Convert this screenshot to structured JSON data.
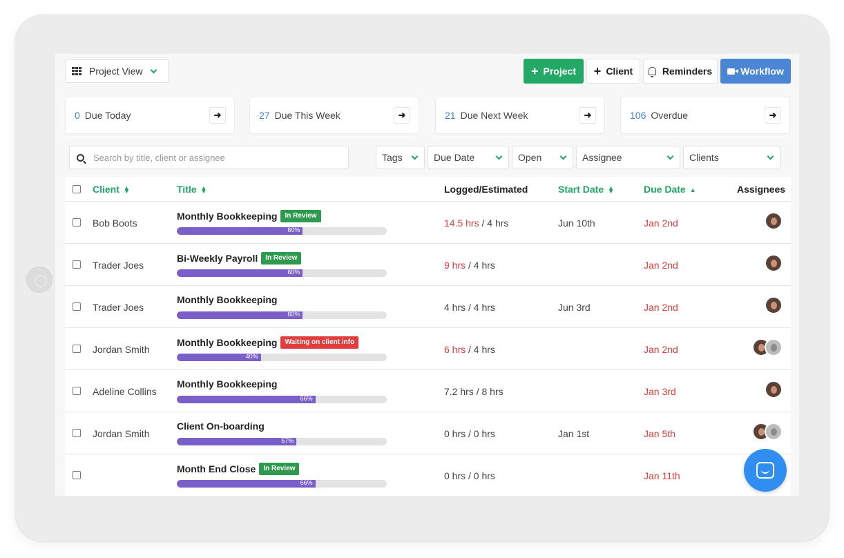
{
  "toolbar": {
    "view_label": "Project View",
    "project_label": "Project",
    "client_label": "Client",
    "reminders_label": "Reminders",
    "workflow_label": "Workflow"
  },
  "due_cards": [
    {
      "count": "0",
      "label": "Due Today"
    },
    {
      "count": "27",
      "label": "Due This Week"
    },
    {
      "count": "21",
      "label": "Due Next Week"
    },
    {
      "count": "106",
      "label": "Overdue"
    }
  ],
  "search": {
    "placeholder": "Search by title, client or assignee"
  },
  "filters": {
    "tags": "Tags",
    "due_date": "Due Date",
    "status": "Open",
    "assignee": "Assignee",
    "clients": "Clients"
  },
  "table": {
    "headers": {
      "client": "Client",
      "title": "Title",
      "logged": "Logged/Estimated",
      "start": "Start Date",
      "due": "Due Date",
      "assignees": "Assignees"
    },
    "rows": [
      {
        "client": "Bob Boots",
        "title": "Monthly Bookkeeping",
        "badge": "In Review",
        "progress_label": "60%",
        "logged": "14.5 hrs",
        "estimated": "/ 4 hrs",
        "start": "Jun 10th",
        "due": "Jan 2nd"
      },
      {
        "client": "Trader Joes",
        "title": "Bi-Weekly Payroll",
        "badge": "In Review",
        "progress_label": "60%",
        "logged": "9 hrs",
        "estimated": "/ 4 hrs",
        "start": "",
        "due": "Jan 2nd"
      },
      {
        "client": "Trader Joes",
        "title": "Monthly Bookkeeping",
        "badge": "",
        "progress_label": "60%",
        "logged": "4 hrs",
        "estimated": "/ 4 hrs",
        "start": "Jun 3rd",
        "due": "Jan 2nd"
      },
      {
        "client": "Jordan Smith",
        "title": "Monthly Bookkeeping",
        "badge": "Waiting on client info",
        "progress_label": "40%",
        "logged": "6 hrs",
        "estimated": "/ 4 hrs",
        "start": "",
        "due": "Jan 2nd"
      },
      {
        "client": "Adeline Collins",
        "title": "Monthly Bookkeeping",
        "badge": "",
        "progress_label": "66%",
        "logged": "7.2 hrs",
        "estimated": "/ 8 hrs",
        "start": "",
        "due": "Jan 3rd"
      },
      {
        "client": "Jordan Smith",
        "title": "Client On-boarding",
        "badge": "",
        "progress_label": "57%",
        "logged": "0 hrs",
        "estimated": "/ 0 hrs",
        "start": "Jan 1st",
        "due": "Jan 5th"
      },
      {
        "client": "",
        "title": "Month End Close",
        "badge": "In Review",
        "progress_label": "66%",
        "logged": "0 hrs",
        "estimated": "/ 0 hrs",
        "start": "",
        "due": "Jan 11th"
      }
    ]
  },
  "progress_values": [
    0.6,
    0.6,
    0.6,
    0.4,
    0.66,
    0.57,
    0.66
  ],
  "colors": {
    "accent_green": "#23a866",
    "workflow_blue": "#4a86d4",
    "overdue_red": "#e33b3b",
    "progress_purple": "#7b5fc9",
    "count_blue": "#3b7dd8"
  },
  "icons": {
    "view": "grid-icon",
    "search": "search-icon",
    "reminders": "bell-icon",
    "workflow": "video-icon",
    "chat": "chat-icon",
    "card_arrow": "arrow-right-icon"
  }
}
